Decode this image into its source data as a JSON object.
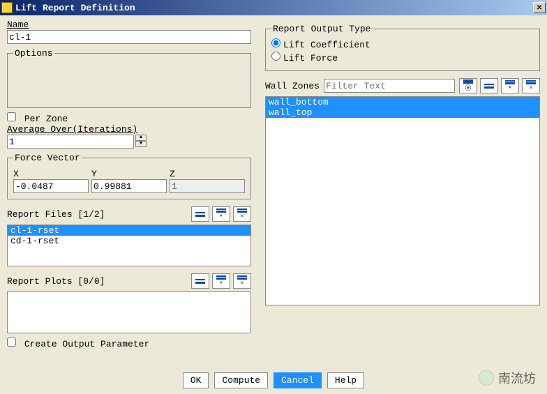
{
  "window": {
    "title": "Lift Report Definition"
  },
  "name": {
    "label": "Name",
    "value": "cl-1"
  },
  "options": {
    "legend": "Options",
    "per_zone_label": "Per Zone",
    "per_zone_checked": false,
    "avg_label": "Average Over(Iterations)",
    "avg_value": "1"
  },
  "force_vector": {
    "legend": "Force Vector",
    "x_label": "X",
    "x_value": "-0.0487",
    "y_label": "Y",
    "y_value": "0.99881",
    "z_label": "Z",
    "z_value": "1"
  },
  "report_files": {
    "label": "Report Files [1/2]",
    "items": [
      "cl-1-rset",
      "cd-1-rset"
    ],
    "selected": 0
  },
  "report_plots": {
    "label": "Report Plots [0/0]",
    "items": []
  },
  "create_output": {
    "label": "Create Output Parameter",
    "checked": false
  },
  "output_type": {
    "legend": "Report Output Type",
    "lift_coef": "Lift Coefficient",
    "lift_force": "Lift Force",
    "selected": "lift_coef"
  },
  "wall_zones": {
    "label": "Wall Zones",
    "filter_placeholder": "Filter Text",
    "items": [
      "wall_bottom",
      "wall_top"
    ],
    "selected": [
      0,
      1
    ]
  },
  "icons": {
    "filter": "filter-icon",
    "select_all": "select-all-icon",
    "deselect_all": "deselect-all-icon",
    "invert": "invert-icon"
  },
  "buttons": {
    "ok": "OK",
    "compute": "Compute",
    "cancel": "Cancel",
    "help": "Help"
  },
  "watermark": "南流坊"
}
